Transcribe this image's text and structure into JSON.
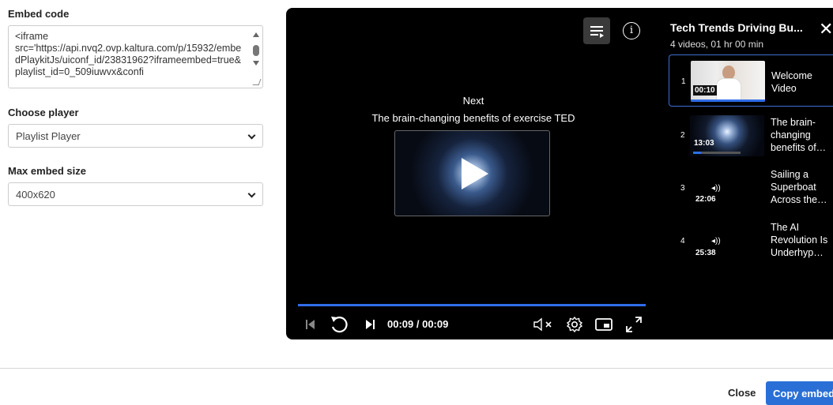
{
  "form": {
    "embed_label": "Embed code",
    "embed_value": "<iframe\nsrc='https://api.nvq2.ovp.kaltura.com/p/15932/embedPlaykitJs/uiconf_id/23831962?iframeembed=true&playlist_id=0_509iuwvx&confi",
    "player_label": "Choose player",
    "player_value": "Playlist Player",
    "size_label": "Max embed size",
    "size_value": "400x620"
  },
  "player": {
    "next_label": "Next",
    "next_title": "The brain-changing benefits of exercise TED",
    "time": "00:09 / 00:09",
    "progress_fraction": 1.0
  },
  "playlist": {
    "title": "Tech Trends Driving Bu...",
    "subtitle": "4 videos, 01 hr 00 min",
    "items": [
      {
        "num": "1",
        "duration": "00:10",
        "title": "Welcome Video"
      },
      {
        "num": "2",
        "duration": "13:03",
        "title": "The brain-changing benefits of…"
      },
      {
        "num": "3",
        "duration": "22:06",
        "title": "Sailing a Superboat Across the…"
      },
      {
        "num": "4",
        "duration": "25:38",
        "title": "The AI Revolution Is Underhyp…"
      }
    ]
  },
  "footer": {
    "close_label": "Close",
    "copy_label": "Copy embed"
  },
  "colors": {
    "accent": "#2a6fd6",
    "progress": "#2f6de8"
  }
}
